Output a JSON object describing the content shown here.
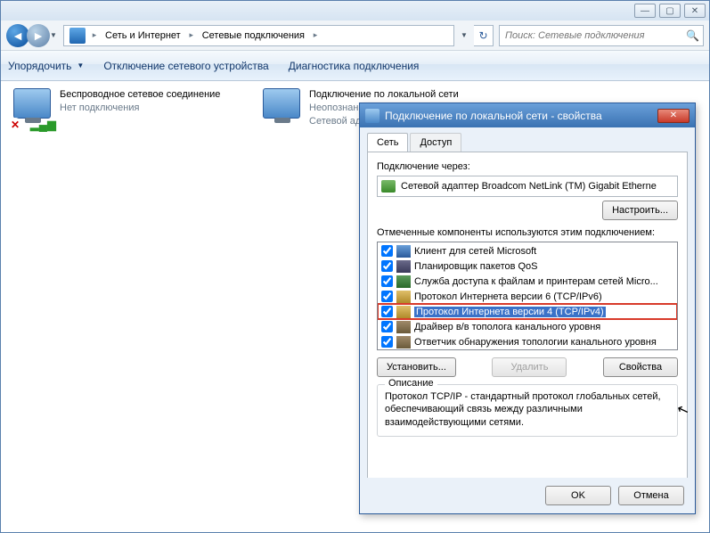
{
  "window": {
    "breadcrumb": [
      "Сеть и Интернет",
      "Сетевые подключения"
    ],
    "search_placeholder": "Поиск: Сетевые подключения"
  },
  "toolbar": {
    "organize": "Упорядочить",
    "disable": "Отключение сетевого устройства",
    "diagnose": "Диагностика подключения"
  },
  "connections": [
    {
      "name": "Беспроводное сетевое соединение",
      "line2": "",
      "line3": "Нет подключения",
      "overlay": "x",
      "signal": true
    },
    {
      "name": "Подключение по локальной сети",
      "line2": "Неопознанная сеть",
      "line3": "Сетевой адаптер",
      "overlay": "",
      "signal": false
    }
  ],
  "dialog": {
    "title": "Подключение по локальной сети - свойства",
    "tabs": {
      "network": "Сеть",
      "access": "Доступ"
    },
    "connect_via_label": "Подключение через:",
    "adapter": "Сетевой адаптер Broadcom NetLink (TM) Gigabit Etherne",
    "configure_btn": "Настроить...",
    "components_label": "Отмеченные компоненты используются этим подключением:",
    "components": [
      {
        "label": "Клиент для сетей Microsoft",
        "checked": true,
        "icon": "cli"
      },
      {
        "label": "Планировщик пакетов QoS",
        "checked": true,
        "icon": "sched"
      },
      {
        "label": "Служба доступа к файлам и принтерам сетей Micro...",
        "checked": true,
        "icon": "share"
      },
      {
        "label": "Протокол Интернета версии 6 (TCP/IPv6)",
        "checked": true,
        "icon": "proto"
      },
      {
        "label": "Протокол Интернета версии 4 (TCP/IPv4)",
        "checked": true,
        "icon": "proto",
        "selected": true
      },
      {
        "label": "Драйвер в/в тополога канального уровня",
        "checked": true,
        "icon": "drv"
      },
      {
        "label": "Ответчик обнаружения топологии канального уровня",
        "checked": true,
        "icon": "resp"
      }
    ],
    "install_btn": "Установить...",
    "uninstall_btn": "Удалить",
    "properties_btn": "Свойства",
    "desc_legend": "Описание",
    "desc_text": "Протокол TCP/IP - стандартный протокол глобальных сетей, обеспечивающий связь между различными взаимодействующими сетями.",
    "ok_btn": "OK",
    "cancel_btn": "Отмена"
  }
}
